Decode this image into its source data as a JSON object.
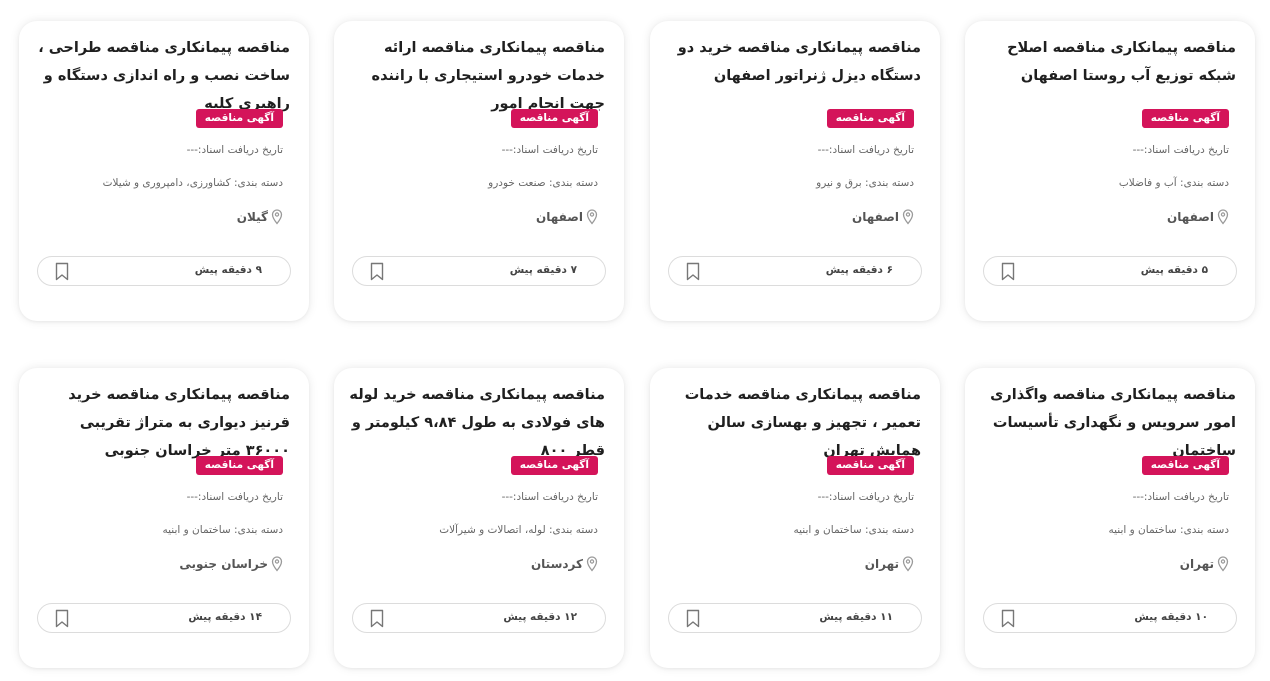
{
  "cards": [
    {
      "title": "مناقصه پیمانکاری مناقصه اصلاح شبکه توزیع آب روستا اصفهان",
      "badge": "آگهی مناقصه",
      "receive_date": "تاریخ دریافت اسناد:---",
      "category": "دسته بندی: آب و فاضلاب",
      "location": "اصفهان",
      "time": "۵ دقیقه پیش"
    },
    {
      "title": "مناقصه پیمانکاری مناقصه خرید دو دستگاه دیزل ژنراتور اصفهان",
      "badge": "آگهی مناقصه",
      "receive_date": "تاریخ دریافت اسناد:---",
      "category": "دسته بندی: برق و نیرو",
      "location": "اصفهان",
      "time": "۶ دقیقه پیش"
    },
    {
      "title": "مناقصه پیمانکاری مناقصه ارائه خدمات خودرو استیجاری با راننده جهت انجام امور",
      "badge": "آگهی مناقصه",
      "receive_date": "تاریخ دریافت اسناد:---",
      "category": "دسته بندی: صنعت خودرو",
      "location": "اصفهان",
      "time": "۷ دقیقه پیش"
    },
    {
      "title": "مناقصه پیمانکاری مناقصه طراحی ، ساخت نصب و راه اندازی دستگاه و راهبری کلیه",
      "badge": "آگهی مناقصه",
      "receive_date": "تاریخ دریافت اسناد:---",
      "category": "دسته بندی: کشاورزی، دامپروری و شیلات",
      "location": "گیلان",
      "time": "۹ دقیقه پیش"
    },
    {
      "title": "مناقصه پیمانکاری مناقصه واگذاری امور سرویس و نگهداری تأسیسات ساختمان",
      "badge": "آگهی مناقصه",
      "receive_date": "تاریخ دریافت اسناد:---",
      "category": "دسته بندی: ساختمان و ابنیه",
      "location": "تهران",
      "time": "۱۰ دقیقه پیش"
    },
    {
      "title": "مناقصه پیمانکاری مناقصه خدمات تعمیر ، تجهیز و بهسازی سالن همایش تهران",
      "badge": "آگهی مناقصه",
      "receive_date": "تاریخ دریافت اسناد:---",
      "category": "دسته بندی: ساختمان و ابنیه",
      "location": "تهران",
      "time": "۱۱ دقیقه پیش"
    },
    {
      "title": "مناقصه پیمانکاری مناقصه خرید لوله های فولادی به طول ۹،۸۴ کیلومتر و قطر ۸۰۰",
      "badge": "آگهی مناقصه",
      "receive_date": "تاریخ دریافت اسناد:---",
      "category": "دسته بندی: لوله، اتصالات و شیرآلات",
      "location": "کردستان",
      "time": "۱۲ دقیقه پیش"
    },
    {
      "title": "مناقصه پیمانکاری مناقصه خرید قرنیز دیواری به متراژ تقریبی ۳۶۰۰۰ متر خراسان جنوبی",
      "badge": "آگهی مناقصه",
      "receive_date": "تاریخ دریافت اسناد:---",
      "category": "دسته بندی: ساختمان و ابنیه",
      "location": "خراسان جنوبی",
      "time": "۱۴ دقیقه پیش"
    }
  ],
  "icons": {
    "location": "map-pin-icon",
    "bookmark": "bookmark-icon"
  },
  "colors": {
    "badge": "#d4145a",
    "card_bg": "#ffffff",
    "text": "#1f1f1f"
  }
}
